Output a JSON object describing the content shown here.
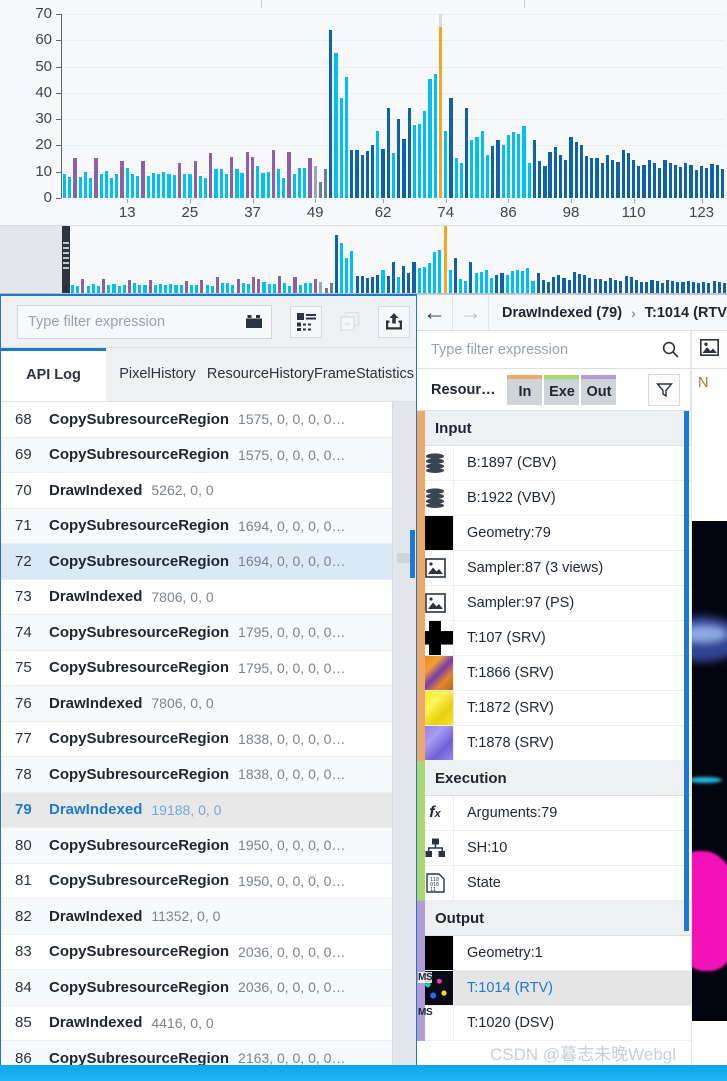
{
  "chart_data": {
    "type": "bar",
    "title": "",
    "xlabel": "",
    "ylabel": "",
    "ylim": [
      0,
      70
    ],
    "yticks": [
      0,
      10,
      20,
      30,
      40,
      50,
      60,
      70
    ],
    "xticks": [
      13,
      25,
      37,
      49,
      62,
      74,
      86,
      98,
      110,
      123
    ],
    "grid": true,
    "legend": "none",
    "x_start": 1,
    "x_end": 128,
    "selected_index": 79,
    "colors": {
      "cyan": "#00BFF3",
      "purple": "#8E5FA8",
      "dark_blue": "#0F62A8",
      "mid_blue": "#1473C6",
      "slate": "#6B7E91",
      "selected_orange": "#F5A623",
      "selected_cap": "#D9DCE1",
      "plot_bg": "#F7F8FA",
      "grid": "#ECEEF1",
      "axis": "#5A6472"
    },
    "values": [
      9,
      8,
      15.2,
      8,
      10,
      7.5,
      15.3,
      9,
      10.2,
      7.5,
      9.2,
      14,
      11.5,
      9,
      8.5,
      14.2,
      8.5,
      9.5,
      9.2,
      10,
      9,
      8.8,
      13.3,
      9,
      9.3,
      14.2,
      8.5,
      7.8,
      17.3,
      11,
      11.2,
      9,
      15.5,
      11,
      9.5,
      17.4,
      15.5,
      12.2,
      9.4,
      9.8,
      18.2,
      11,
      7.5,
      17.4,
      9,
      11.3,
      11.3,
      15.4,
      12.2,
      6,
      11.2,
      64,
      55.3,
      38,
      46,
      18.3,
      18.2,
      16.5,
      18,
      20.2,
      25.5,
      18.5,
      34.1,
      17.2,
      30.1,
      22.3,
      34.2,
      27.6,
      28.3,
      33.2,
      45.2,
      47.3,
      65,
      25.5,
      38.2,
      15.4,
      13.3,
      34.1,
      22.2,
      23.3,
      25.4,
      16.4,
      19.6,
      22.2,
      20.3,
      24,
      25.2,
      24.2,
      27.3,
      13.3,
      22.1,
      14.2,
      12,
      17.5,
      19.3,
      16.5,
      14.5,
      23.3,
      21.2,
      20.2,
      16,
      15.4,
      15.4,
      13.5,
      16.4,
      14.4,
      13.6,
      18.2,
      17.2,
      14.3,
      12.2,
      12.4,
      14.3,
      13.2,
      11.5,
      14.5,
      13.4,
      12.6,
      11.8,
      13.5,
      12.4,
      10.8,
      12.2,
      11.4,
      13.1,
      12.5,
      11.2
    ],
    "series_kinds": [
      "cyan",
      "cyan",
      "purple",
      "cyan",
      "cyan",
      "cyan",
      "purple",
      "cyan",
      "cyan",
      "cyan",
      "cyan",
      "purple",
      "cyan",
      "cyan",
      "cyan",
      "purple",
      "cyan",
      "cyan",
      "cyan",
      "cyan",
      "cyan",
      "cyan",
      "purple",
      "cyan",
      "cyan",
      "purple",
      "cyan",
      "cyan",
      "purple",
      "cyan",
      "cyan",
      "cyan",
      "purple",
      "cyan",
      "cyan",
      "purple",
      "purple",
      "cyan",
      "cyan",
      "cyan",
      "purple",
      "cyan",
      "cyan",
      "purple",
      "cyan",
      "cyan",
      "cyan",
      "purple",
      "slatelight",
      "slate",
      "slate",
      "dark",
      "cyan",
      "cyan",
      "cyan",
      "dark",
      "dark",
      "dark",
      "dark",
      "dark",
      "cyan",
      "dark",
      "dark",
      "cyan",
      "dark",
      "dark",
      "dark",
      "cyan",
      "cyan",
      "cyan",
      "cyan",
      "cyan",
      "selected",
      "cyan",
      "dark",
      "cyan",
      "cyan",
      "dark",
      "cyan",
      "cyan",
      "cyan",
      "cyan",
      "dark",
      "dark",
      "cyan",
      "cyan",
      "cyan",
      "cyan",
      "cyan",
      "cyan",
      "dark",
      "dark",
      "dark",
      "dark",
      "dark",
      "dark",
      "dark",
      "dark",
      "dark",
      "dark",
      "dark",
      "dark",
      "dark",
      "dark",
      "dark",
      "dark",
      "dark",
      "dark",
      "dark",
      "dark",
      "dark",
      "dark",
      "dark",
      "dark",
      "dark",
      "dark",
      "dark",
      "dark",
      "dark",
      "dark",
      "dark",
      "dark",
      "dark",
      "dark",
      "dark",
      "dark",
      "dark"
    ]
  },
  "overview": {
    "handle_label": "viewport-handle"
  },
  "left_panel": {
    "filter": {
      "placeholder": "Type filter expression",
      "value": ""
    },
    "toolbar_icons": [
      {
        "name": "capture-icon",
        "label": "Capture"
      },
      {
        "name": "list-details-icon",
        "label": "Details View"
      },
      {
        "name": "copy-icon",
        "label": "Copy"
      },
      {
        "name": "export-icon",
        "label": "Export"
      }
    ],
    "tabs": [
      {
        "label": "API Log",
        "active": true
      },
      {
        "label": "Pixel\nHistory",
        "active": false
      },
      {
        "label": "Resource\nHistory",
        "active": false
      },
      {
        "label": "Frame\nStatistics",
        "active": false
      }
    ],
    "tab_labels_flat": [
      "API Log",
      "Pixel History",
      "Resource History",
      "Frame Statistics"
    ],
    "rows": [
      {
        "idx": "68",
        "name": "CopySubresourceRegion",
        "args": "1575, 0, 0, 0, 0…",
        "state": "normal"
      },
      {
        "idx": "69",
        "name": "CopySubresourceRegion",
        "args": "1575, 0, 0, 0, 0…",
        "state": "alt"
      },
      {
        "idx": "70",
        "name": "DrawIndexed",
        "args": "5262, 0, 0",
        "state": "normal"
      },
      {
        "idx": "71",
        "name": "CopySubresourceRegion",
        "args": "1694, 0, 0, 0, 0…",
        "state": "alt"
      },
      {
        "idx": "72",
        "name": "CopySubresourceRegion",
        "args": "1694, 0, 0, 0, 0…",
        "state": "selected"
      },
      {
        "idx": "73",
        "name": "DrawIndexed",
        "args": "7806, 0, 0",
        "state": "normal"
      },
      {
        "idx": "74",
        "name": "CopySubresourceRegion",
        "args": "1795, 0, 0, 0, 0…",
        "state": "alt"
      },
      {
        "idx": "75",
        "name": "CopySubresourceRegion",
        "args": "1795, 0, 0, 0, 0…",
        "state": "normal"
      },
      {
        "idx": "76",
        "name": "DrawIndexed",
        "args": "7806, 0, 0",
        "state": "alt"
      },
      {
        "idx": "77",
        "name": "CopySubresourceRegion",
        "args": "1838, 0, 0, 0, 0…",
        "state": "normal"
      },
      {
        "idx": "78",
        "name": "CopySubresourceRegion",
        "args": "1838, 0, 0, 0, 0…",
        "state": "alt"
      },
      {
        "idx": "79",
        "name": "DrawIndexed",
        "args": "19188, 0, 0",
        "state": "current"
      },
      {
        "idx": "80",
        "name": "CopySubresourceRegion",
        "args": "1950, 0, 0, 0, 0…",
        "state": "alt"
      },
      {
        "idx": "81",
        "name": "CopySubresourceRegion",
        "args": "1950, 0, 0, 0, 0…",
        "state": "normal"
      },
      {
        "idx": "82",
        "name": "DrawIndexed",
        "args": "11352, 0, 0",
        "state": "alt"
      },
      {
        "idx": "83",
        "name": "CopySubresourceRegion",
        "args": "2036, 0, 0, 0, 0…",
        "state": "normal"
      },
      {
        "idx": "84",
        "name": "CopySubresourceRegion",
        "args": "2036, 0, 0, 0, 0…",
        "state": "alt"
      },
      {
        "idx": "85",
        "name": "DrawIndexed",
        "args": "4416, 0, 0",
        "state": "normal"
      },
      {
        "idx": "86",
        "name": "CopySubresourceRegion",
        "args": "2163, 0, 0, 0, 0…",
        "state": "alt"
      }
    ]
  },
  "right_panel": {
    "breadcrumb": {
      "back": "←",
      "forward": "→",
      "item1": "DrawIndexed (79)",
      "separator": "›",
      "item2": "T:1014 (RTV"
    },
    "filter": {
      "placeholder": "Type filter expression",
      "value": ""
    },
    "toolbar": {
      "column_label": "Resour…",
      "segments": [
        {
          "label": "In",
          "color": "#F0A868"
        },
        {
          "label": "Exe",
          "color": "#A8D870"
        },
        {
          "label": "Out",
          "color": "#B49BD8"
        }
      ],
      "funnel_icon": "filter-funnel-icon"
    },
    "groups": [
      {
        "title": "Input",
        "stripe": "#F0A868",
        "items": [
          {
            "label": "B:1897 (CBV)",
            "icon": "buffer-icon",
            "thumb": "none",
            "selected": false
          },
          {
            "label": "B:1922 (VBV)",
            "icon": "buffer-icon",
            "thumb": "none",
            "selected": false
          },
          {
            "label": "Geometry:79",
            "icon": "geometry-icon",
            "thumb": "black",
            "selected": false
          },
          {
            "label": "Sampler:87 (3 views)",
            "icon": "sampler-icon",
            "thumb": "none",
            "selected": false
          },
          {
            "label": "Sampler:97 (PS)",
            "icon": "sampler-icon",
            "thumb": "none",
            "selected": false
          },
          {
            "label": "T:107 (SRV)",
            "icon": "texture-cross-icon",
            "thumb": "cross",
            "selected": false
          },
          {
            "label": "T:1866 (SRV)",
            "icon": "texture-icon",
            "thumb": "orange",
            "selected": false
          },
          {
            "label": "T:1872 (SRV)",
            "icon": "texture-icon",
            "thumb": "yellow",
            "selected": false
          },
          {
            "label": "T:1878 (SRV)",
            "icon": "texture-icon",
            "thumb": "purple",
            "selected": false
          }
        ]
      },
      {
        "title": "Execution",
        "stripe": "#A8D870",
        "items": [
          {
            "label": "Arguments:79",
            "icon": "fx-icon",
            "thumb": "none",
            "selected": false
          },
          {
            "label": "SH:10",
            "icon": "shader-icon",
            "thumb": "none",
            "selected": false
          },
          {
            "label": "State",
            "icon": "state-icon",
            "thumb": "none",
            "selected": false
          }
        ]
      },
      {
        "title": "Output",
        "stripe": "#B49BD8",
        "items": [
          {
            "label": "Geometry:1",
            "icon": "geometry-icon",
            "thumb": "black",
            "selected": false
          },
          {
            "label": "T:1014 (RTV)",
            "icon": "texture-ms-icon",
            "thumb": "ms-dark",
            "selected": true,
            "ms": "MS"
          },
          {
            "label": "T:1020 (DSV)",
            "icon": "texture-ms-icon",
            "thumb": "ms-white",
            "selected": false,
            "ms": "MS"
          }
        ]
      }
    ],
    "preview": {
      "toolbar_icon": "image-preview-icon",
      "label": "N"
    }
  },
  "watermark": "CSDN @暮志未晚Webgl"
}
